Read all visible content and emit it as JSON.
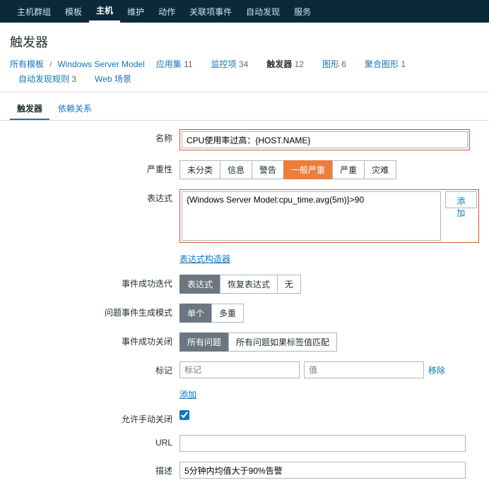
{
  "topnav": {
    "items": [
      "主机群组",
      "模板",
      "主机",
      "维护",
      "动作",
      "关联项事件",
      "自动发现",
      "服务"
    ],
    "activeIndex": 2
  },
  "pageTitle": "触发器",
  "breadcrumb": {
    "allTemplates": "所有模板",
    "template": "Windows Server Model",
    "items": [
      {
        "label": "应用集",
        "count": 11
      },
      {
        "label": "监控项",
        "count": 34
      },
      {
        "label": "触发器",
        "count": 12,
        "active": true
      },
      {
        "label": "图形",
        "count": 6
      },
      {
        "label": "聚合图形",
        "count": 1
      },
      {
        "label": "自动发现规则",
        "count": 3
      },
      {
        "label": "Web 场景",
        "count": ""
      }
    ]
  },
  "tabs": {
    "trigger": "触发器",
    "deps": "依赖关系"
  },
  "form": {
    "nameLabel": "名称",
    "nameValue": "CPU使用率过高：{HOST.NAME}",
    "severityLabel": "严重性",
    "severities": [
      "未分类",
      "信息",
      "警告",
      "一般严重",
      "严重",
      "灾难"
    ],
    "severityActive": 3,
    "exprLabel": "表达式",
    "exprValue": "{Windows Server Model:cpu_time.avg(5m)}>90",
    "addBtn": "添加",
    "exprBuilder": "表达式构造器",
    "okIterLabel": "事件成功迭代",
    "okIterOptions": [
      "表达式",
      "恢复表达式",
      "无"
    ],
    "okIterActive": 0,
    "problemModeLabel": "问题事件生成模式",
    "problemModeOptions": [
      "单个",
      "多重"
    ],
    "problemModeActive": 0,
    "okCloseLabel": "事件成功关闭",
    "okCloseOptions": [
      "所有问题",
      "所有问题如果标签值匹配"
    ],
    "okCloseActive": 0,
    "tagsLabel": "标记",
    "tagPlaceholder": "标记",
    "valPlaceholder": "值",
    "removeLink": "移除",
    "addLink": "添加",
    "manualCloseLabel": "允许手动关闭",
    "manualCloseChecked": true,
    "urlLabel": "URL",
    "urlValue": "",
    "descLabel": "描述",
    "descValue": "5分钟内均值大于90%告警"
  }
}
